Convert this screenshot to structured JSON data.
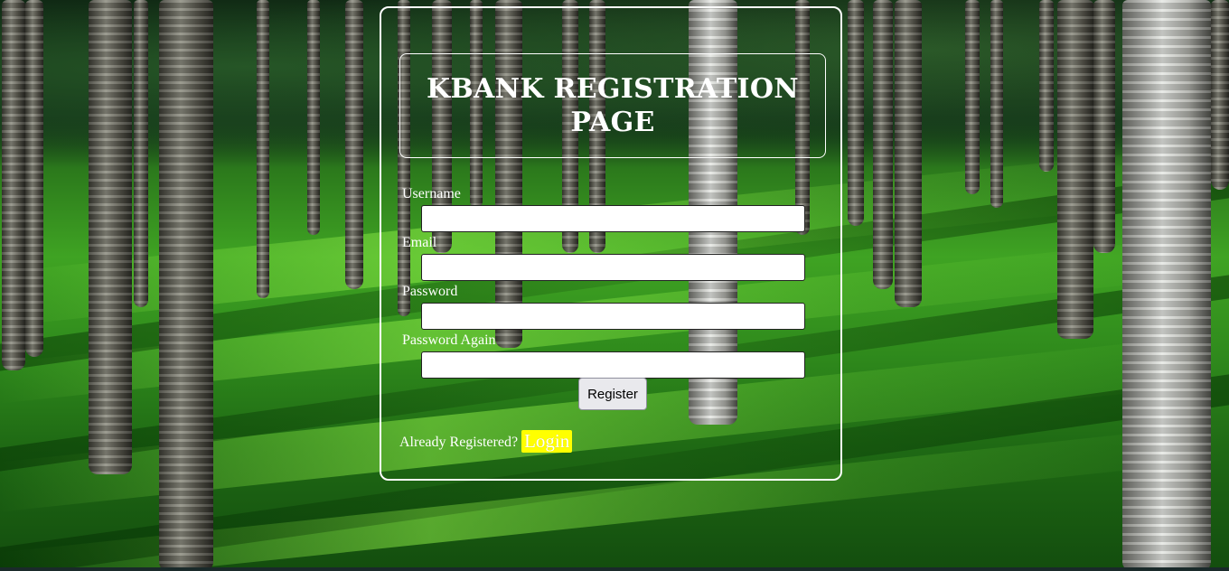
{
  "page": {
    "title": "KBANK REGISTRATION PAGE"
  },
  "form": {
    "username_label": "Username",
    "username_value": "",
    "email_label": "Email",
    "email_value": "",
    "password_label": "Password",
    "password_value": "",
    "password_again_label": "Password Again",
    "password_again_value": "",
    "register_label": "Register"
  },
  "footer": {
    "already_text": "Already Registered?",
    "login_label": "Login"
  },
  "colors": {
    "text": "#ffffff",
    "border": "#ffffff",
    "login_highlight": "#ffff00",
    "background_grass": "#3fa323"
  },
  "icons": {
    "background": "palm-forest-background"
  }
}
